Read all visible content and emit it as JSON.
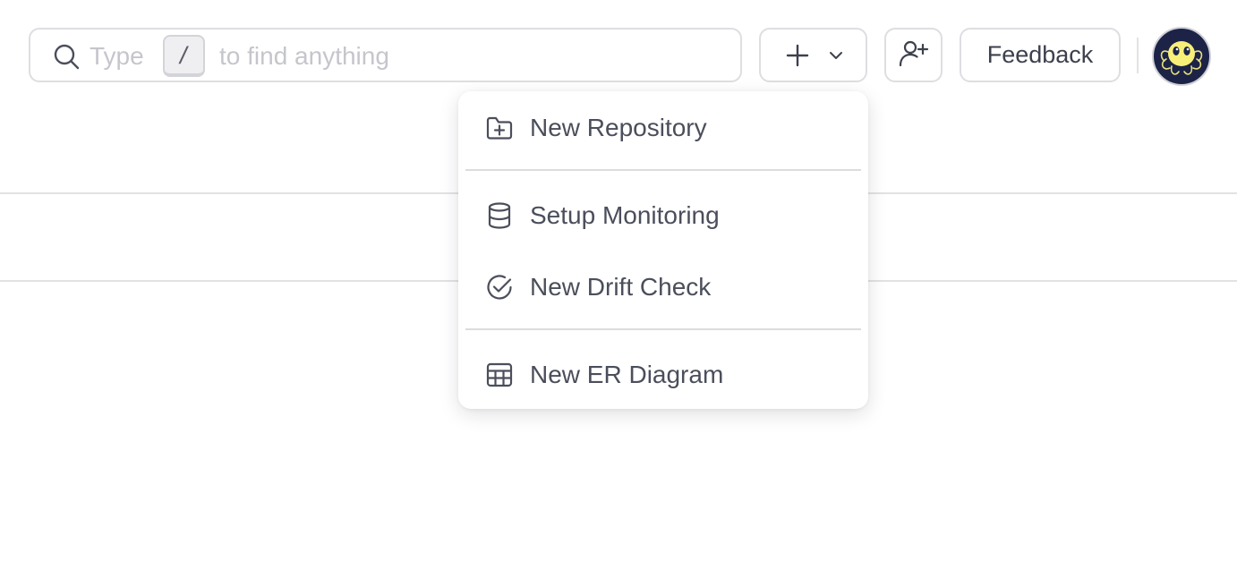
{
  "search": {
    "placeholder_before": "Type",
    "shortcut_key": "/",
    "placeholder_after": "to find anything"
  },
  "toolbar": {
    "feedback_label": "Feedback"
  },
  "create_menu": {
    "items": [
      {
        "label": "New Repository",
        "icon": "folder-plus-icon"
      },
      {
        "label": "Setup Monitoring",
        "icon": "database-icon"
      },
      {
        "label": "New Drift Check",
        "icon": "circle-check-icon"
      },
      {
        "label": "New ER Diagram",
        "icon": "table-icon"
      }
    ]
  },
  "colors": {
    "text": "#4b4e5b",
    "border": "#dedee2",
    "placeholder": "#c5c6cc",
    "avatar_bg": "#1c2347",
    "avatar_face": "#f7ef78"
  }
}
